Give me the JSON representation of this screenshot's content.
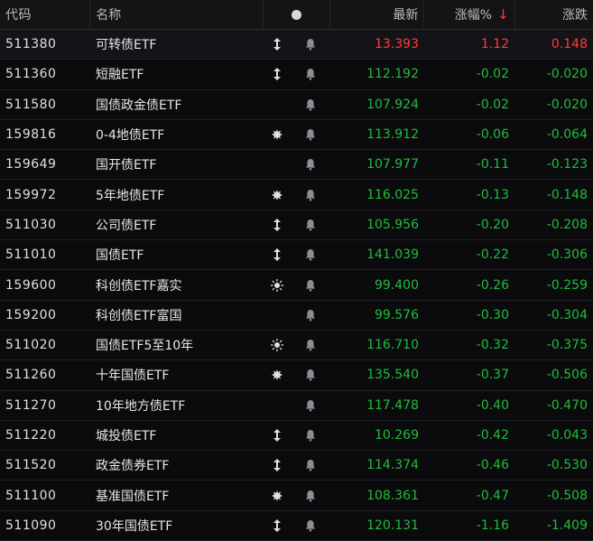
{
  "header": {
    "code": "代码",
    "name": "名称",
    "last": "最新",
    "pct": "涨幅%",
    "sort_arrow": "↓",
    "chg": "涨跌"
  },
  "colors": {
    "up": "#ff3b3b",
    "down": "#1fbd3b"
  },
  "rows": [
    {
      "code": "511380",
      "name": "可转债ETF",
      "icon": "updown-arrows-icon",
      "last": "13.393",
      "pct": "1.12",
      "chg": "0.148",
      "dir": "up"
    },
    {
      "code": "511360",
      "name": "短融ETF",
      "icon": "updown-arrows-icon",
      "last": "112.192",
      "pct": "-0.02",
      "chg": "-0.020",
      "dir": "down"
    },
    {
      "code": "511580",
      "name": "国债政金债ETF",
      "icon": "",
      "last": "107.924",
      "pct": "-0.02",
      "chg": "-0.020",
      "dir": "down"
    },
    {
      "code": "159816",
      "name": "0-4地债ETF",
      "icon": "burst-icon",
      "last": "113.912",
      "pct": "-0.06",
      "chg": "-0.064",
      "dir": "down"
    },
    {
      "code": "159649",
      "name": "国开债ETF",
      "icon": "",
      "last": "107.977",
      "pct": "-0.11",
      "chg": "-0.123",
      "dir": "down"
    },
    {
      "code": "159972",
      "name": "5年地债ETF",
      "icon": "burst-icon",
      "last": "116.025",
      "pct": "-0.13",
      "chg": "-0.148",
      "dir": "down"
    },
    {
      "code": "511030",
      "name": "公司债ETF",
      "icon": "updown-arrows-icon",
      "last": "105.956",
      "pct": "-0.20",
      "chg": "-0.208",
      "dir": "down"
    },
    {
      "code": "511010",
      "name": "国债ETF",
      "icon": "updown-arrows-icon",
      "last": "141.039",
      "pct": "-0.22",
      "chg": "-0.306",
      "dir": "down"
    },
    {
      "code": "159600",
      "name": "科创债ETF嘉实",
      "icon": "sun-icon",
      "last": "99.400",
      "pct": "-0.26",
      "chg": "-0.259",
      "dir": "down"
    },
    {
      "code": "159200",
      "name": "科创债ETF富国",
      "icon": "",
      "last": "99.576",
      "pct": "-0.30",
      "chg": "-0.304",
      "dir": "down"
    },
    {
      "code": "511020",
      "name": "国债ETF5至10年",
      "icon": "sun-icon",
      "last": "116.710",
      "pct": "-0.32",
      "chg": "-0.375",
      "dir": "down"
    },
    {
      "code": "511260",
      "name": "十年国债ETF",
      "icon": "burst-icon",
      "last": "135.540",
      "pct": "-0.37",
      "chg": "-0.506",
      "dir": "down"
    },
    {
      "code": "511270",
      "name": "10年地方债ETF",
      "icon": "",
      "last": "117.478",
      "pct": "-0.40",
      "chg": "-0.470",
      "dir": "down"
    },
    {
      "code": "511220",
      "name": "城投债ETF",
      "icon": "updown-arrows-icon",
      "last": "10.269",
      "pct": "-0.42",
      "chg": "-0.043",
      "dir": "down"
    },
    {
      "code": "511520",
      "name": "政金债券ETF",
      "icon": "updown-arrows-icon",
      "last": "114.374",
      "pct": "-0.46",
      "chg": "-0.530",
      "dir": "down"
    },
    {
      "code": "511100",
      "name": "基准国债ETF",
      "icon": "burst-icon",
      "last": "108.361",
      "pct": "-0.47",
      "chg": "-0.508",
      "dir": "down"
    },
    {
      "code": "511090",
      "name": "30年国债ETF",
      "icon": "updown-arrows-icon",
      "last": "120.131",
      "pct": "-1.16",
      "chg": "-1.409",
      "dir": "down"
    }
  ]
}
